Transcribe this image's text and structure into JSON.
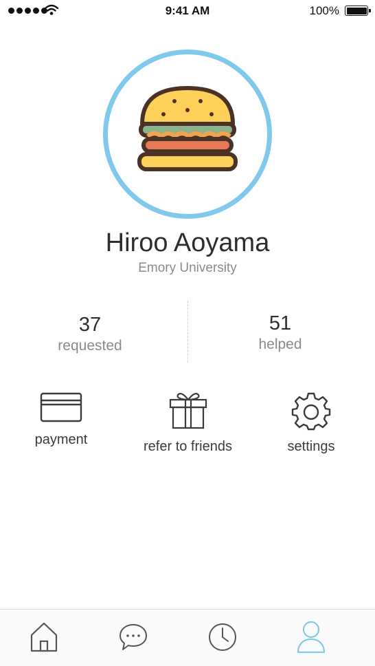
{
  "status_bar": {
    "time": "9:41 AM",
    "battery": "100%"
  },
  "profile": {
    "name": "Hiroo Aoyama",
    "school": "Emory University",
    "avatar_icon": "hamburger-icon"
  },
  "stats": {
    "requested": {
      "value": "37",
      "label": "requested"
    },
    "helped": {
      "value": "51",
      "label": "helped"
    }
  },
  "actions": {
    "payment": {
      "label": "payment",
      "icon": "credit-card-icon"
    },
    "refer": {
      "label": "refer to friends",
      "icon": "gift-icon"
    },
    "settings": {
      "label": "settings",
      "icon": "gear-icon"
    }
  },
  "tab_bar": {
    "active": "profile",
    "tabs": [
      "home-icon",
      "chat-icon",
      "clock-icon",
      "profile-icon"
    ]
  },
  "colors": {
    "accent": "#80c9ed",
    "text": "#2d2d2d",
    "muted": "#8a8a8a"
  }
}
